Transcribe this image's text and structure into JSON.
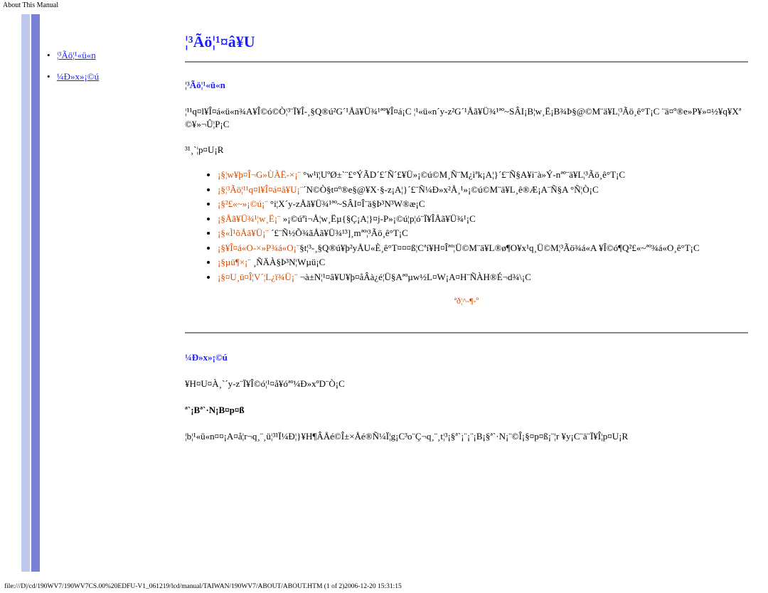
{
  "corner_title": "About This Manual",
  "sidebar": {
    "items": [
      {
        "label": "¦³Ãö¦¹«ü«n"
      },
      {
        "label": "¼Ð»x»¡©ú"
      }
    ]
  },
  "main": {
    "title": "¦³Ãö¦¹¤â¥U",
    "section1": {
      "heading": "¦³Ãö¦¹«ü«n",
      "p1": "¦¹¹q¤l¥Î¤á«ü«n¾A¥Î©ó©Ò¦³¨Ï¥Î-¸§Q®ú²G´¹Åã¥Ü¾¹ªº¥Î¤á¡C ¦¹«ü«n´y-z²G´¹Åã¥Ü¾¹ªº~SÂI¡B¦w¸Ë¡B¾Þ§@©M¨ä¥L¦³Ãö¸ê°T¡C ¨ä¤º®e»P¥»¤½¥q¥Xª©¥»¬Û¦P¡C",
      "p2": "³¹¸`¦p¤U¡R",
      "list": [
        {
          "hl": "¡§¦w¥þ¤Î¬G»ÙÀË-×¡¨",
          "tail": " °w¹ï¦UºØ±`¨£°ÝÃD´£´Ñ´£¥Ü»¡©ú©M¸Ñ¨M¿ìªk¡A¦}´£¨Ñ§A¥i¨à»Ý-nªº¨ä¥L¦³Ãö¸ê°T¡C"
        },
        {
          "hl": "¡§¦³Ãö¦¹¹q¤l¥Î¤á¤â¥U¡¨",
          "tail": "´N©Ò§t¤º®e§@¥X·§-z¡A¦}´£¨Ñ¼Ð»x²Å¸¹»¡©ú©M¨ä¥L¸ê®Æ¡A¨Ñ§A °Ñ¦Ò¡C"
        },
        {
          "hl": "¡§²£«~»¡©ú¡¨",
          "tail": " °i¦X´y-zÅã¥Ü¾¹ªº~SÂI¤Î¨ä§Þ³N³W®æ¡C"
        },
        {
          "hl": "¡§Åã¥Ü¾¹¦w¸Ë¡¨",
          "tail": " »¡©úªì¬Å¦w¸Ëµ{§Ç¡A¦}¤j-P»¡©ú¦p¦ó¨Ï¥ÎÅã¥Ü¾¹¡C"
        },
        {
          "hl": "¡§«Ì¹õÅã¥Ü¡¨",
          "tail": " ´£¨Ñ½Õ¾ãÅã¥Ü¾¹³]¸mªº¦³Ãö¸ê°T¡C"
        },
        {
          "hl": "¡§¥Î¤á«O-×»P¾á«O¡¨",
          "tail": "§t¦³-¸§Q®ú¥þ²yÅU«È¸ê°T¤¤¤ß¦Cªí¥H¤Îªº¦Ü©M¨ä¥L®ø¶O¥x¹q¸Ü©M¦³Ãö¾á«A ¥Î©ó¶Q²£«~ªº¾á«O¸ê°T¡C"
        },
        {
          "hl": "¡§µü¶×¡¨",
          "tail": " ¸ÑÄÀ§Þ³N¦Wµü¡C"
        },
        {
          "hl": "¡§¤U¸ü¤Î¦V´¦L¿ï¾Ü¡¨",
          "tail": " ¬à±N¦¹¤â¥U¥þ¤åÂà¿é¦Ü§Aªºµw½L¤W¡A¤H¨ÑÀH®É¬d¾\\¡C"
        }
      ],
      "back_top": "ªð¦^-¶-º"
    },
    "section2": {
      "heading": "¼Ð»x»¡©ú",
      "p1": "¥H¤U¤À¸`´y-z¨Ï¥Î©ó¦¹¤å¥óªº¼Ð»xºD¨Ò¡C",
      "sub": "ª`¡Bª`·N¡B¤p¤ß",
      "p2": "¦b¦¹«ü«n¤¤¡A¤å¦r¬q¸¨¸ü¦³¹Ï¼Ð¦}¥H¶ÂÅé©Î±×Åé®Ñ¼Ï¦g¡C³o¨Ç¬q¸¨¸t¦³¡§ª`¡¨¡¨¡B¡§ª`·N¡¨©Î¡§¤p¤ß¡¨¦r ¥y¡C¨ä¨Ï¥Î¦p¤U¡R"
    }
  },
  "footer_path": "file:///D|/cd/190WV7/190WV7CS.00%20EDFU-V1_061219/lcd/manual/TAIWAN/190WV7/ABOUT/ABOUT.HTM (1 of 2)2006-12-20 15:31:15"
}
